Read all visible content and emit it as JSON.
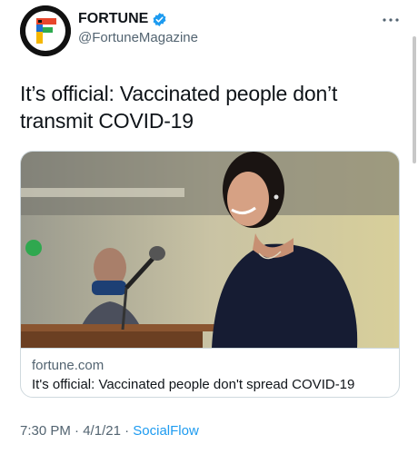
{
  "account": {
    "display_name": "FORTUNE",
    "handle": "@FortuneMagazine",
    "avatar_icon": "fortune-logo-icon",
    "verified_icon": "verified-badge-icon",
    "verified_color": "#1d9bf0"
  },
  "tweet": {
    "text": "It’s official: Vaccinated people don’t transmit COVID-19"
  },
  "card": {
    "domain": "fortune.com",
    "title": "It's official: Vaccinated people don't spread COVID-19"
  },
  "footer": {
    "time": "7:30 PM",
    "separator": "·",
    "date": "4/1/21",
    "source": "SocialFlow"
  },
  "colors": {
    "accent": "#1d9bf0",
    "secondary_text": "#536471",
    "border": "#cfd9de"
  }
}
